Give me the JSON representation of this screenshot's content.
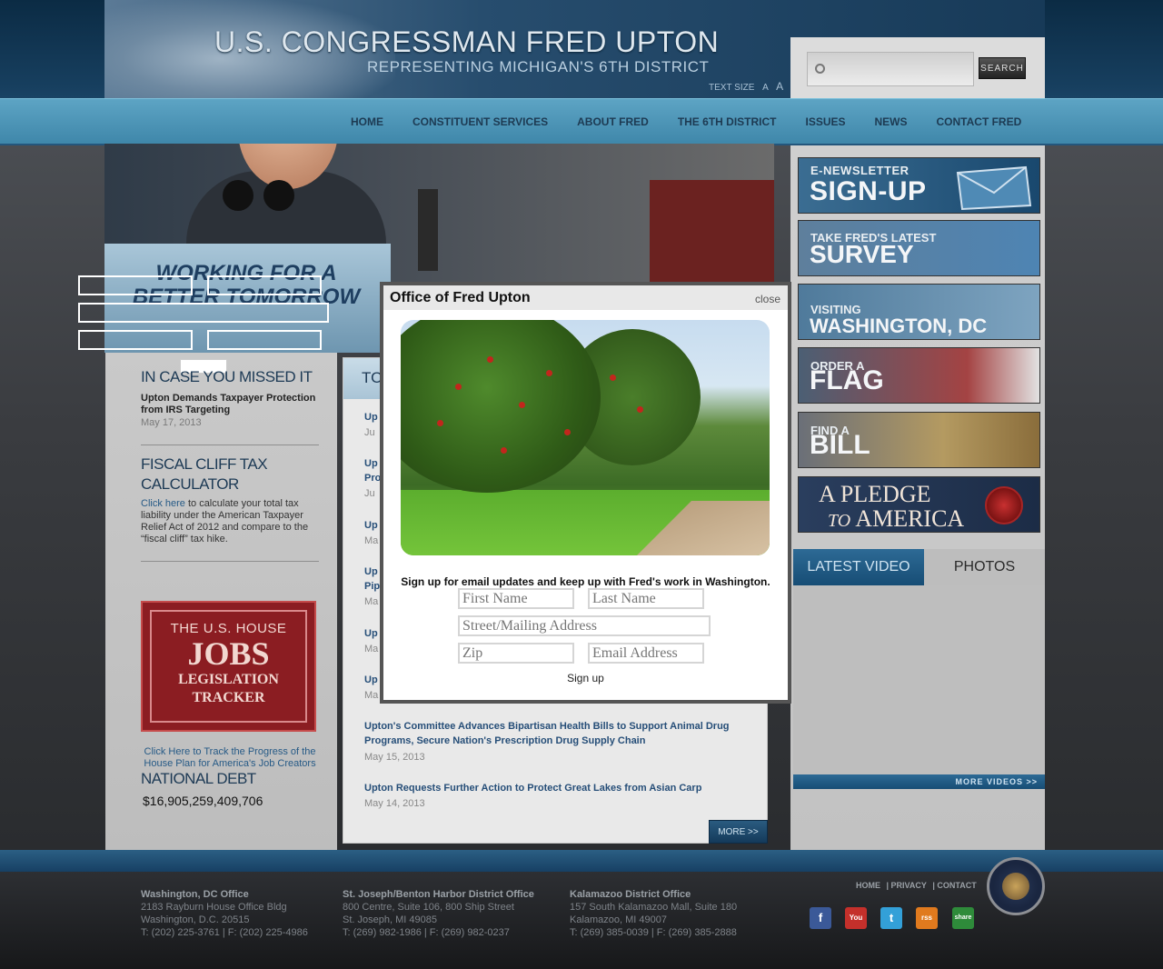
{
  "header": {
    "title": "U.S. CONGRESSMAN FRED UPTON",
    "subtitle": "REPRESENTING MICHIGAN'S 6TH DISTRICT",
    "text_size_label": "TEXT SIZE",
    "text_size_options": [
      "A",
      "A",
      "A"
    ],
    "search_placeholder": "",
    "search_button": "SEARCH"
  },
  "nav": [
    "HOME",
    "CONSTITUENT SERVICES",
    "ABOUT FRED",
    "THE 6TH DISTRICT",
    "ISSUES",
    "NEWS",
    "CONTACT FRED"
  ],
  "hero": {
    "tagline_1": "WORKING FOR A",
    "tagline_2": "BETTER TOMORROW"
  },
  "left": {
    "missed_title": "IN CASE YOU MISSED IT",
    "missed_item": "Upton Demands Taxpayer Protection from IRS Targeting",
    "missed_date": "May 17, 2013",
    "fiscal_title_1": "FISCAL CLIFF TAX",
    "fiscal_title_2": "CALCULATOR",
    "fiscal_link": "Click here",
    "fiscal_text": " to calculate your total tax liability under the American Taxpayer Relief Act of 2012 and compare to the “fiscal cliff” tax hike.",
    "jobs_line1": "THE U.S. HOUSE",
    "jobs_line2": "JOBS",
    "jobs_line3": "LEGISLATION",
    "jobs_line4": "TRACKER",
    "jobs_caption": "Click Here to Track the Progress of the House Plan for America's Job Creators",
    "debt_title": "NATIONAL DEBT",
    "debt_value": "$16,905,259,409,706"
  },
  "center": {
    "head": "TO",
    "items": [
      {
        "title": "Up",
        "date": "Ju"
      },
      {
        "title": "Up\nPro",
        "date": "Ju"
      },
      {
        "title": "Up",
        "date": "Ma"
      },
      {
        "title": "Up\nPip",
        "date": "Ma"
      },
      {
        "title": "Up",
        "date": "Ma"
      },
      {
        "title": "Up",
        "date": "Ma"
      },
      {
        "title": "Upton's Committee Advances Bipartisan Health Bills to Support Animal Drug Programs, Secure Nation's Prescription Drug Supply Chain",
        "date": "May 15, 2013"
      },
      {
        "title": "Upton Requests Further Action to Protect Great Lakes from Asian Carp",
        "date": "May 14, 2013"
      }
    ],
    "more": "MORE >>"
  },
  "right": {
    "banners": [
      {
        "small": "E-NEWSLETTER",
        "big": "SIGN-UP"
      },
      {
        "small": "TAKE FRED'S LATEST",
        "big": "SURVEY"
      },
      {
        "small": "VISITING",
        "big": "WASHINGTON, DC"
      },
      {
        "small": "ORDER A",
        "big": "FLAG"
      },
      {
        "small": "FIND A",
        "big": "BILL"
      }
    ],
    "pledge_1": "A PLEDGE",
    "pledge_2_a": "TO",
    "pledge_2_b": "AMERICA",
    "tab_video": "LATEST VIDEO",
    "tab_photos": "PHOTOS",
    "more_videos": "MORE VIDEOS >>"
  },
  "modal": {
    "title": "Office of Fred Upton",
    "close": "close",
    "text": "Sign up for email updates and keep up with Fred's work in Washington.",
    "first_name": "First Name",
    "last_name": "Last Name",
    "address": "Street/Mailing Address",
    "zip": "Zip",
    "email": "Email Address",
    "signup": "Sign up"
  },
  "footer": {
    "offices": [
      {
        "name": "Washington, DC Office",
        "l1": "2183 Rayburn House Office Bldg",
        "l2": "Washington, D.C. 20515",
        "l3": "T: (202) 225-3761 | F: (202) 225-4986"
      },
      {
        "name": "St. Joseph/Benton Harbor District Office",
        "l1": "800 Centre, Suite 106, 800 Ship Street",
        "l2": "St. Joseph, MI 49085",
        "l3": "T: (269) 982-1986 | F: (269) 982-0237"
      },
      {
        "name": "Kalamazoo District Office",
        "l1": "157 South Kalamazoo Mall, Suite 180",
        "l2": "Kalamazoo, MI 49007",
        "l3": "T: (269) 385-0039 | F: (269) 385-2888"
      }
    ],
    "links": [
      "HOME",
      "| PRIVACY",
      "| CONTACT"
    ],
    "social": [
      "f",
      "You",
      "t",
      "rss",
      "share"
    ],
    "social_colors": [
      "#3b5998",
      "#c4302b",
      "#33a0d8",
      "#e07a1e",
      "#2e8b3a"
    ]
  }
}
